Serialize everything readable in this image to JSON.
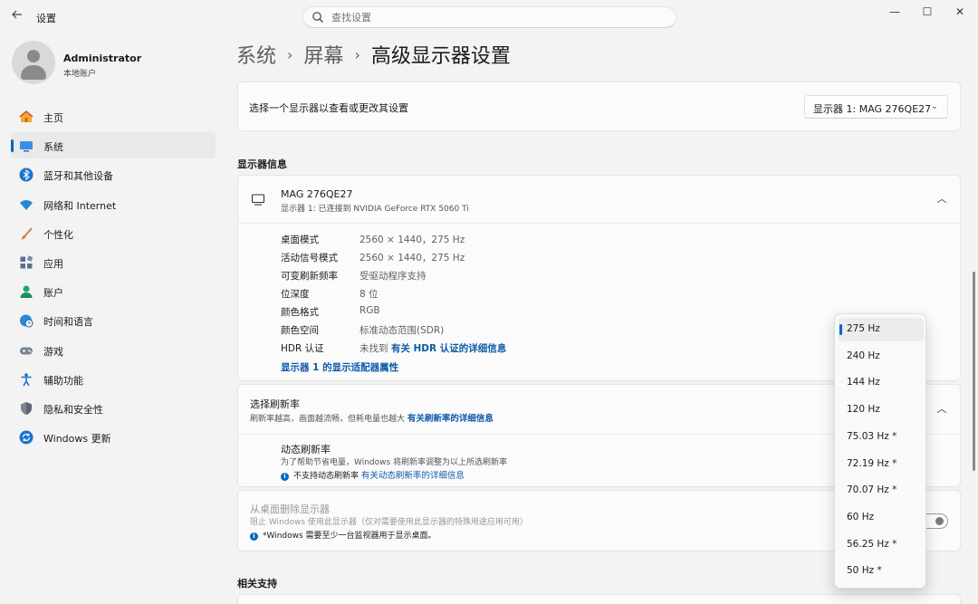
{
  "window": {
    "title": "设置",
    "minimize": "—",
    "maximize": "☐",
    "close": "✕"
  },
  "search": {
    "placeholder": "查找设置"
  },
  "user": {
    "name": "Administrator",
    "account": "本地账户"
  },
  "nav": [
    {
      "label": "主页",
      "icon": "home-icon"
    },
    {
      "label": "系统",
      "icon": "system-icon",
      "active": true
    },
    {
      "label": "蓝牙和其他设备",
      "icon": "bluetooth-icon"
    },
    {
      "label": "网络和 Internet",
      "icon": "wifi-icon"
    },
    {
      "label": "个性化",
      "icon": "brush-icon"
    },
    {
      "label": "应用",
      "icon": "apps-icon"
    },
    {
      "label": "账户",
      "icon": "account-icon"
    },
    {
      "label": "时间和语言",
      "icon": "globe-clock-icon"
    },
    {
      "label": "游戏",
      "icon": "gamepad-icon"
    },
    {
      "label": "辅助功能",
      "icon": "accessibility-icon"
    },
    {
      "label": "隐私和安全性",
      "icon": "shield-icon"
    },
    {
      "label": "Windows 更新",
      "icon": "update-icon"
    }
  ],
  "breadcrumb": {
    "part1": "系统",
    "part2": "屏幕",
    "current": "高级显示器设置",
    "sep": "›"
  },
  "selector": {
    "label": "选择一个显示器以查看或更改其设置",
    "value": "显示器 1: MAG 276QE27"
  },
  "display_info": {
    "heading": "显示器信息",
    "monitor_name": "MAG 276QE27",
    "monitor_sub": "显示器 1: 已连接到 NVIDIA GeForce RTX 5060 Ti",
    "rows": [
      {
        "label": "桌面模式",
        "value": "2560 × 1440，275 Hz"
      },
      {
        "label": "活动信号模式",
        "value": "2560 × 1440，275 Hz"
      },
      {
        "label": "可变刷新频率",
        "value": "受驱动程序支持"
      },
      {
        "label": "位深度",
        "value": "8 位"
      },
      {
        "label": "颜色格式",
        "value": "RGB"
      },
      {
        "label": "颜色空间",
        "value": "标准动态范围(SDR)"
      }
    ],
    "hdr_label": "HDR 认证",
    "hdr_value": "未找到",
    "hdr_link": "有关 HDR 认证的详细信息",
    "adapter_link": "显示器 1 的显示适配器属性"
  },
  "refresh": {
    "title": "选择刷新率",
    "desc": "刷新率越高，画面越流畅，但耗电量也越大",
    "link": "有关刷新率的详细信息",
    "dynamic_title": "动态刷新率",
    "dynamic_desc": "为了帮助节省电量，Windows 将刷新率调整为以上所选刷新率",
    "dynamic_note": "不支持动态刷新率",
    "dynamic_link": "有关动态刷新率的详细信息"
  },
  "remove_display": {
    "title": "从桌面删除显示器",
    "desc": "阻止 Windows 使用此显示器（仅对需要使用此显示器的特殊用途应用可用）",
    "note": "*Windows 需要至少一台监视器用于显示桌面。",
    "toggle_on": false
  },
  "related": {
    "heading": "相关支持"
  },
  "refresh_options": [
    "275 Hz",
    "240 Hz",
    "144 Hz",
    "120 Hz",
    "75.03 Hz *",
    "72.19 Hz *",
    "70.07 Hz *",
    "60 Hz",
    "56.25 Hz *",
    "50 Hz *"
  ],
  "selected_option": 0,
  "colors": {
    "accent": "#0067c0",
    "link": "#0f5aa8"
  }
}
